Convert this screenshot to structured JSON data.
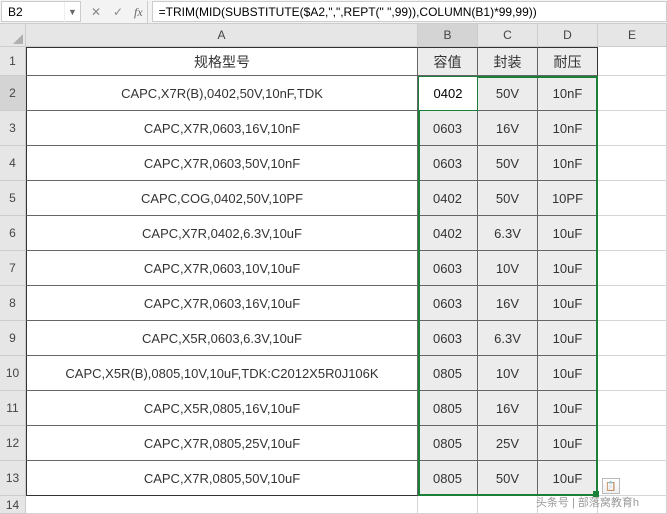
{
  "formula_bar": {
    "cell_ref": "B2",
    "formula": "=TRIM(MID(SUBSTITUTE($A2,\",\",REPT(\" \",99)),COLUMN(B1)*99,99))"
  },
  "columns": [
    "A",
    "B",
    "C",
    "D",
    "E"
  ],
  "headers": {
    "A": "规格型号",
    "B": "容值",
    "C": "封装",
    "D": "耐压"
  },
  "rows": [
    {
      "n": "1"
    },
    {
      "n": "2",
      "A": "CAPC,X7R(B),0402,50V,10nF,TDK",
      "B": "0402",
      "C": "50V",
      "D": "10nF"
    },
    {
      "n": "3",
      "A": "CAPC,X7R,0603,16V,10nF",
      "B": "0603",
      "C": "16V",
      "D": "10nF"
    },
    {
      "n": "4",
      "A": "CAPC,X7R,0603,50V,10nF",
      "B": "0603",
      "C": "50V",
      "D": "10nF"
    },
    {
      "n": "5",
      "A": "CAPC,COG,0402,50V,10PF",
      "B": "0402",
      "C": "50V",
      "D": "10PF"
    },
    {
      "n": "6",
      "A": "CAPC,X7R,0402,6.3V,10uF",
      "B": "0402",
      "C": "6.3V",
      "D": "10uF"
    },
    {
      "n": "7",
      "A": "CAPC,X7R,0603,10V,10uF",
      "B": "0603",
      "C": "10V",
      "D": "10uF"
    },
    {
      "n": "8",
      "A": "CAPC,X7R,0603,16V,10uF",
      "B": "0603",
      "C": "16V",
      "D": "10uF"
    },
    {
      "n": "9",
      "A": "CAPC,X5R,0603,6.3V,10uF",
      "B": "0603",
      "C": "6.3V",
      "D": "10uF"
    },
    {
      "n": "10",
      "A": "CAPC,X5R(B),0805,10V,10uF,TDK:C2012X5R0J106K",
      "B": "0805",
      "C": "10V",
      "D": "10uF"
    },
    {
      "n": "11",
      "A": "CAPC,X5R,0805,16V,10uF",
      "B": "0805",
      "C": "16V",
      "D": "10uF"
    },
    {
      "n": "12",
      "A": "CAPC,X7R,0805,25V,10uF",
      "B": "0805",
      "C": "25V",
      "D": "10uF"
    },
    {
      "n": "13",
      "A": "CAPC,X7R,0805,50V,10uF",
      "B": "0805",
      "C": "50V",
      "D": "10uF"
    },
    {
      "n": "14"
    }
  ],
  "active_cell_value": "0402",
  "watermark": "头条号 | 部落窝教育h",
  "chart_data": {
    "type": "table",
    "title": "规格型号",
    "columns": [
      "规格型号",
      "容值",
      "封装",
      "耐压"
    ],
    "rows": [
      [
        "CAPC,X7R(B),0402,50V,10nF,TDK",
        "0402",
        "50V",
        "10nF"
      ],
      [
        "CAPC,X7R,0603,16V,10nF",
        "0603",
        "16V",
        "10nF"
      ],
      [
        "CAPC,X7R,0603,50V,10nF",
        "0603",
        "50V",
        "10nF"
      ],
      [
        "CAPC,COG,0402,50V,10PF",
        "0402",
        "50V",
        "10PF"
      ],
      [
        "CAPC,X7R,0402,6.3V,10uF",
        "0402",
        "6.3V",
        "10uF"
      ],
      [
        "CAPC,X7R,0603,10V,10uF",
        "0603",
        "10V",
        "10uF"
      ],
      [
        "CAPC,X7R,0603,16V,10uF",
        "0603",
        "16V",
        "10uF"
      ],
      [
        "CAPC,X5R,0603,6.3V,10uF",
        "0603",
        "6.3V",
        "10uF"
      ],
      [
        "CAPC,X5R(B),0805,10V,10uF,TDK:C2012X5R0J106K",
        "0805",
        "10V",
        "10uF"
      ],
      [
        "CAPC,X5R,0805,16V,10uF",
        "0805",
        "16V",
        "10uF"
      ],
      [
        "CAPC,X7R,0805,25V,10uF",
        "0805",
        "25V",
        "10uF"
      ],
      [
        "CAPC,X7R,0805,50V,10uF",
        "0805",
        "50V",
        "10uF"
      ]
    ]
  }
}
